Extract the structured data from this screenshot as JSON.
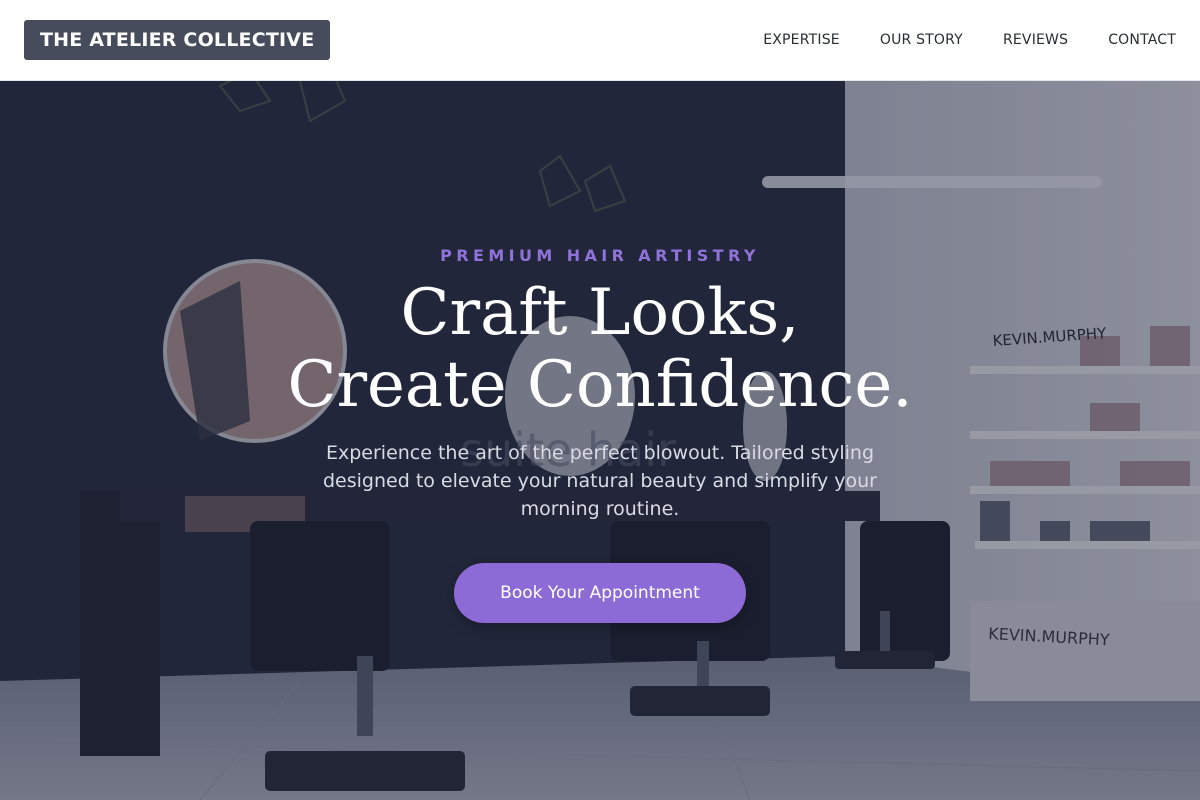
{
  "brand": {
    "name": "THE ATELIER COLLECTIVE"
  },
  "nav": {
    "items": [
      {
        "label": "EXPERTISE"
      },
      {
        "label": "OUR STORY"
      },
      {
        "label": "REVIEWS"
      },
      {
        "label": "CONTACT"
      }
    ]
  },
  "hero": {
    "eyebrow": "PREMIUM HAIR ARTISTRY",
    "headline_line1": "Craft Looks,",
    "headline_line2": "Create Confidence.",
    "subtitle": "Experience the art of the perfect blowout. Tailored styling designed to elevate your natural beauty and simplify your morning routine.",
    "cta_label": "Book Your Appointment",
    "background_image": "salon-interior-photo",
    "wall_brand_text": "KEVIN.MURPHY",
    "wall_sign_text": "suite hair"
  },
  "colors": {
    "accent": "#8c6bd6",
    "eyebrow": "#8f73d8",
    "logo_bg": "#464c5c",
    "header_bg": "#ffffff"
  }
}
